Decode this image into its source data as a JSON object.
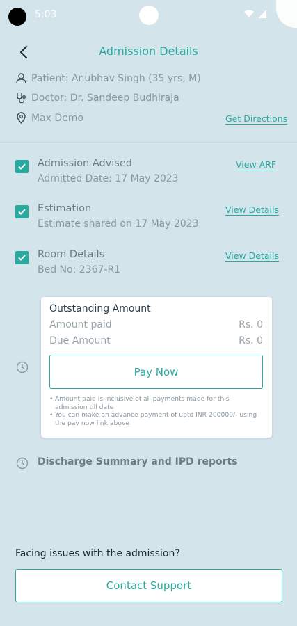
{
  "status_bar": {
    "time": "5:03"
  },
  "header": {
    "title": "Admission Details"
  },
  "info": {
    "patient": "Patient: Anubhav Singh (35 yrs, M)",
    "doctor": "Doctor: Dr. Sandeep Budhiraja",
    "location": "Max Demo",
    "directions_label": "Get Directions"
  },
  "steps": [
    {
      "title": "Admission Advised",
      "subtitle": "Admitted Date: 17 May 2023",
      "link": "View ARF"
    },
    {
      "title": "Estimation",
      "subtitle": "Estimate shared on 17 May 2023",
      "link": "View Details"
    },
    {
      "title": "Room Details",
      "subtitle": "Bed No: 2367-R1",
      "link": "View Details"
    }
  ],
  "outstanding": {
    "title": "Outstanding Amount",
    "paid_label": "Amount paid",
    "paid_value": "Rs. 0",
    "due_label": "Due Amount",
    "due_value": "Rs. 0",
    "pay_label": "Pay Now",
    "notes": [
      "Amount paid is inclusive of all payments made for this admission till date",
      "You can make an advance payment of upto INR 200000/- using the pay now link above"
    ]
  },
  "discharge": {
    "label": "Discharge Summary and IPD reports"
  },
  "support": {
    "issues_label": "Facing issues with the admission?",
    "button_label": "Contact Support"
  },
  "colors": {
    "accent": "#2aa99f",
    "background": "#d3e4eb"
  }
}
